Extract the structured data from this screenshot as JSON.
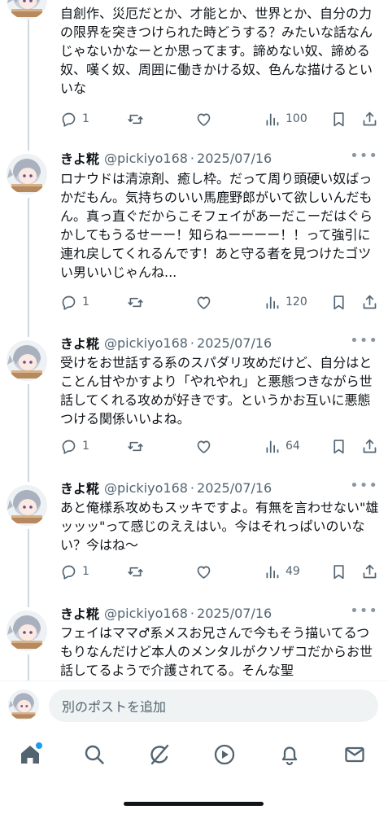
{
  "tweets": [
    {
      "name": "",
      "handle": "",
      "date": "",
      "body": "自創作、災厄だとか、才能とか、世界とか、自分の力の限界を突きつけられた時どうする？みたいな話なんじゃないかなーとか思ってます。諦めない奴、諦める奴、嘆く奴、周囲に働きかける奴、色んな描けるといいな",
      "replies": "1",
      "views": "100"
    },
    {
      "name": "きよ糀",
      "handle": "@pickiyo168",
      "date": "2025/07/16",
      "body": "ロナウドは清涼剤、癒し枠。だって周り頭硬い奴ばっかだもん。気持ちのいい馬鹿野郎がいて欲しいんだもん。真っ直ぐだからこそフェイがあーだこーだはぐらかしてもうるせーー！知らねーーーー！！って強引に連れ戻してくれるんです！あと守る者を見つけたゴツい男いいじゃんね...",
      "replies": "1",
      "views": "120"
    },
    {
      "name": "きよ糀",
      "handle": "@pickiyo168",
      "date": "2025/07/16",
      "body": "受けをお世話する系のスパダリ攻めだけど、自分はとことん甘やかすより「やれやれ」と悪態つきながら世話してくれる攻めが好きです。というかお互いに悪態つける関係いいよね。",
      "replies": "1",
      "views": "64"
    },
    {
      "name": "きよ糀",
      "handle": "@pickiyo168",
      "date": "2025/07/16",
      "body": "あと俺様系攻めもスッキですよ。有無を言わせない\"雄ッッッ\"って感じのええはい。今はそれっぱいのいない？今はね〜",
      "replies": "1",
      "views": "49"
    },
    {
      "name": "きよ糀",
      "handle": "@pickiyo168",
      "date": "2025/07/16",
      "body": "フェイはママ♂系メスお兄さんで今もそう描いてるつもりなんだけど本人のメンタルがクソザコだからお世話してるようで介護されてる。そんな聖",
      "replies": "",
      "views": ""
    }
  ],
  "composer": {
    "placeholder": "別のポストを追加"
  },
  "tabbar": {
    "items": [
      "home-icon",
      "search-icon",
      "grok-icon",
      "video-icon",
      "bell-icon",
      "mail-icon"
    ],
    "active": "home-icon",
    "badge_color": "#1d9bf0"
  },
  "colors": {
    "text": "#0f1419",
    "muted": "#536471",
    "thread_line": "#cfd9de"
  }
}
